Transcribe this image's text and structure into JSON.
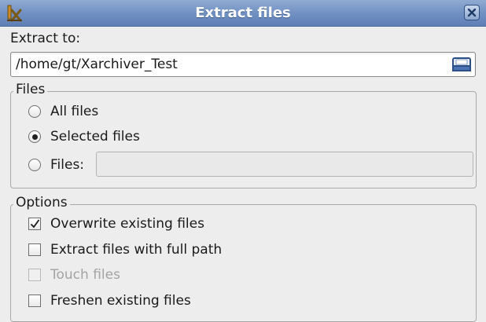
{
  "window": {
    "title": "Extract files",
    "app_icon": "xarchiver-app-icon",
    "close_icon": "close-icon"
  },
  "extract_to": {
    "label": "Extract to:",
    "path": "/home/gt/Xarchiver_Test",
    "browse_icon": "folder-browse-icon"
  },
  "files": {
    "legend": "Files",
    "options": [
      {
        "label": "All files",
        "selected": false
      },
      {
        "label": "Selected files",
        "selected": true
      },
      {
        "label": "Files:",
        "selected": false
      }
    ],
    "files_entry_value": ""
  },
  "options": {
    "legend": "Options",
    "items": [
      {
        "label": "Overwrite existing files",
        "checked": true,
        "enabled": true
      },
      {
        "label": "Extract files with full path",
        "checked": false,
        "enabled": true
      },
      {
        "label": "Touch files",
        "checked": false,
        "enabled": false
      },
      {
        "label": "Freshen existing files",
        "checked": false,
        "enabled": true
      }
    ]
  },
  "colors": {
    "titlebar": "#6f8fc1",
    "background": "#ededed",
    "disabled_text": "#a3a3a3"
  }
}
